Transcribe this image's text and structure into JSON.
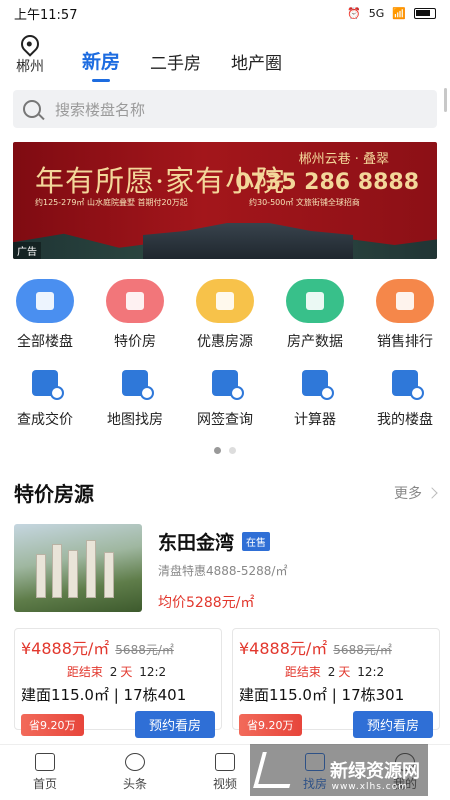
{
  "status": {
    "time": "上午11:57",
    "network": "5G"
  },
  "header": {
    "city": "郴州",
    "tabs": [
      "新房",
      "二手房",
      "地产圈"
    ]
  },
  "search": {
    "placeholder": "搜索楼盘名称"
  },
  "banner": {
    "slogan": "年有所愿·家有小院",
    "brand": "郴州云巷 · 叠翠",
    "phone": "0735 286 8888",
    "line1": "约125-279㎡ 山水庭院叠墅 首期付20万起",
    "line2": "约30-500㎡ 文旅街铺全球招商",
    "ad_label": "广告"
  },
  "grid": [
    {
      "label": "全部楼盘",
      "color": "#4a8ff0"
    },
    {
      "label": "特价房",
      "color": "#f2767a"
    },
    {
      "label": "优惠房源",
      "color": "#f7c24a"
    },
    {
      "label": "房产数据",
      "color": "#38c08a"
    },
    {
      "label": "销售排行",
      "color": "#f5874a"
    },
    {
      "label": "查成交价",
      "color": "#2f78d9"
    },
    {
      "label": "地图找房",
      "color": "#2f78d9"
    },
    {
      "label": "网签查询",
      "color": "#2f78d9"
    },
    {
      "label": "计算器",
      "color": "#2f78d9"
    },
    {
      "label": "我的楼盘",
      "color": "#2f78d9"
    }
  ],
  "section": {
    "title": "特价房源",
    "more": "更多"
  },
  "property": {
    "name": "东田金湾",
    "badge": "在售",
    "desc": "清盘特惠4888-5288/㎡",
    "avg": "均价5288元/㎡"
  },
  "cards": [
    {
      "price": "¥4888元/㎡",
      "old_price": "5688元/㎡",
      "countdown_label": "距结束",
      "days": "2",
      "day_unit": "天",
      "time": "12:2",
      "spec": "建面115.0㎡ | 17栋401",
      "save": "省9.20万",
      "book": "预约看房"
    },
    {
      "price": "¥4888元/㎡",
      "old_price": "5688元/㎡",
      "countdown_label": "距结束",
      "days": "2",
      "day_unit": "天",
      "time": "12:2",
      "spec": "建面115.0㎡ | 17栋301",
      "save": "省9.20万",
      "book": "预约看房"
    }
  ],
  "tabbar": [
    {
      "label": "首页"
    },
    {
      "label": "头条"
    },
    {
      "label": "视频"
    },
    {
      "label": "找房"
    },
    {
      "label": "我的"
    }
  ],
  "watermark": {
    "text": "新绿资源网",
    "url": "www.xlhs.com"
  }
}
